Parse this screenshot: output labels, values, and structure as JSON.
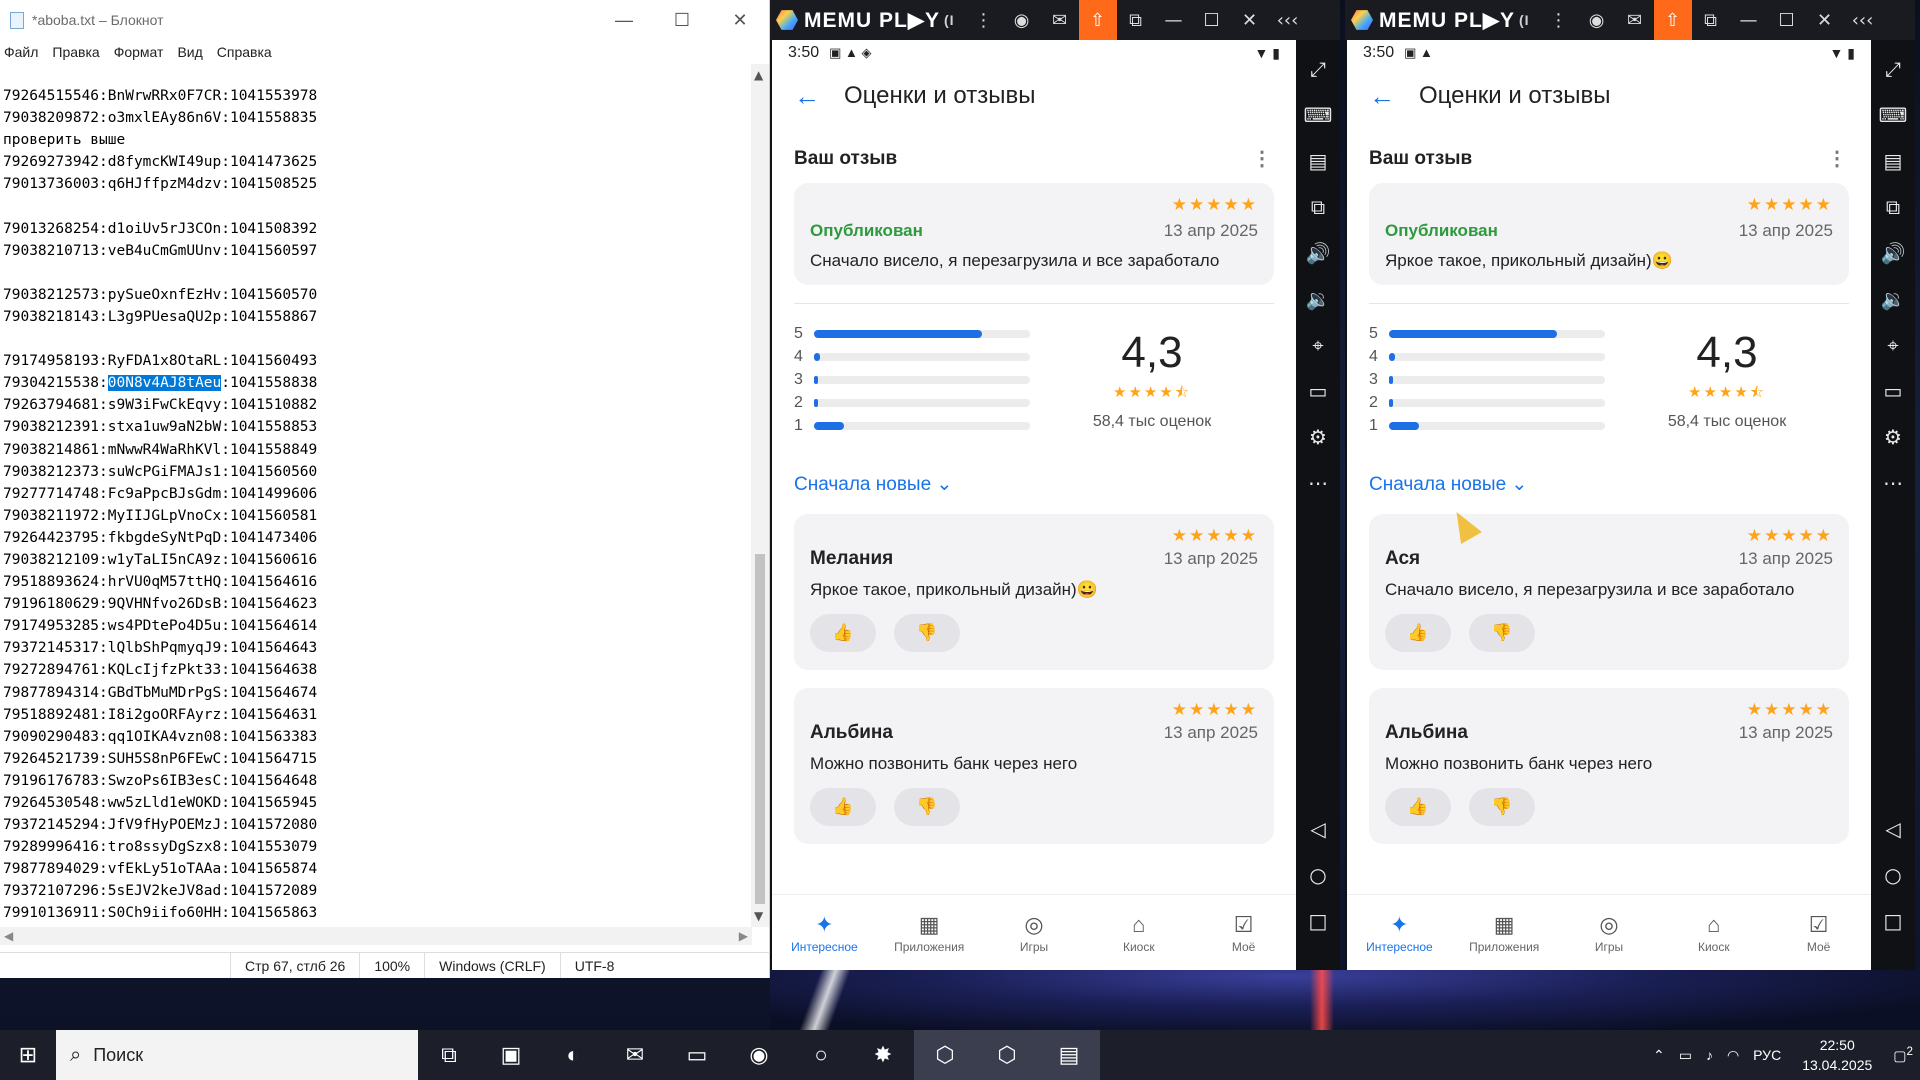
{
  "notepad": {
    "title": "*aboba.txt – Блокнот",
    "menu": [
      "Файл",
      "Правка",
      "Формат",
      "Вид",
      "Справка"
    ],
    "lines_before": "79264515546:BnWrwRRx0F7CR:1041553978\n79038209872:o3mxlEAy86n6V:1041558835\nпроверить выше\n79269273942:d8fymcKWI49up:1041473625\n79013736003:q6HJffpzM4dzv:1041508525\n\n79013268254:d1oiUv5rJ3COn:1041508392\n79038210713:veB4uCmGmUUnv:1041560597\n\n79038212573:pySueOxnfEzHv:1041560570\n79038218143:L3g9PUesaQU2p:1041558867\n\n79174958193:RyFDA1x8OtaRL:1041560493\n",
    "sel_prefix": "79304215538:",
    "sel_text": "00N8v4AJ8tAeu",
    "sel_suffix": ":1041558838",
    "lines_after": "\n79263794681:s9W3iFwCkEqvy:1041510882\n79038212391:stxa1uw9aN2bW:1041558853\n79038214861:mNwwR4WaRhKVl:1041558849\n79038212373:suWcPGiFMAJs1:1041560560\n79277714748:Fc9aPpcBJsGdm:1041499606\n79038211972:MyIIJGLpVnoCx:1041560581\n79264423795:fkbgdeSyNtPqD:1041473406\n79038212109:w1yTaLI5nCA9z:1041560616\n79518893624:hrVU0qM57ttHQ:1041564616\n79196180629:9QVHNfvo26DsB:1041564623\n79174953285:ws4PDtePo4D5u:1041564614\n79372145317:lQlbShPqmyqJ9:1041564643\n79272894761:KQLcIjfzPkt33:1041564638\n79877894314:GBdTbMuMDrPgS:1041564674\n79518892481:I8i2goORFAyrz:1041564631\n79090290483:qq1OIKA4vzn08:1041563383\n79264521739:SUH5S8nP6FEwC:1041564715\n79196176783:SwzoPs6IB3esC:1041564648\n79264530548:ww5zLld1eWOKD:1041565945\n79372145294:JfV9fHyPOEMzJ:1041572080\n79289996416:tro8ssyDgSzx8:1041553079\n79877894029:vfEkLy51oTAAa:1041565874\n79372107296:5sEJV2keJV8ad:1041572089\n79910136911:S0Ch9iifo60HH:1041565863",
    "status": {
      "pos": "Стр 67, стлб 26",
      "zoom": "100%",
      "eol": "Windows (CRLF)",
      "enc": "UTF-8"
    }
  },
  "memu": {
    "logo": "MEMU PL▶Y",
    "logo_suffix": "(I",
    "time": "3:50",
    "page_title": "Оценки и отзывы",
    "your_review": "Ваш отзыв",
    "published": "Опубликован",
    "rating": "4,3",
    "ratings_count": "58,4 тыс оценок",
    "sort": "Сначала новые",
    "stars": "★★★★★",
    "stars_score": "★★★★⯪",
    "bar_labels": [
      "5",
      "4",
      "3",
      "2",
      "1"
    ],
    "bar_values": [
      0.78,
      0.03,
      0.02,
      0.02,
      0.14
    ],
    "nav": [
      "Интересное",
      "Приложения",
      "Игры",
      "Киоск",
      "Моё"
    ],
    "left": {
      "my_date": "13 апр 2025",
      "my_text": "Сначало висело, я перезагрузила и все заработало",
      "r1_name": "Мелания",
      "r1_date": "13 апр 2025",
      "r1_text": "Яркое такое, прикольный дизайн)😀",
      "r2_name": "Альбина",
      "r2_date": "13 апр 2025",
      "r2_text": "Можно позвонить банк через него"
    },
    "right": {
      "my_date": "13 апр 2025",
      "my_text": "Яркое такое, прикольный дизайн)😀",
      "r1_name": "Ася",
      "r1_date": "13 апр 2025",
      "r1_text": "Сначало висело, я перезагрузила и все заработало",
      "r2_name": "Альбина",
      "r2_date": "13 апр 2025",
      "r2_text": "Можно позвонить банк через него"
    }
  },
  "taskbar": {
    "search": "Поиск",
    "lang": "РУС",
    "time": "22:50",
    "date": "13.04.2025",
    "notif": "2"
  }
}
